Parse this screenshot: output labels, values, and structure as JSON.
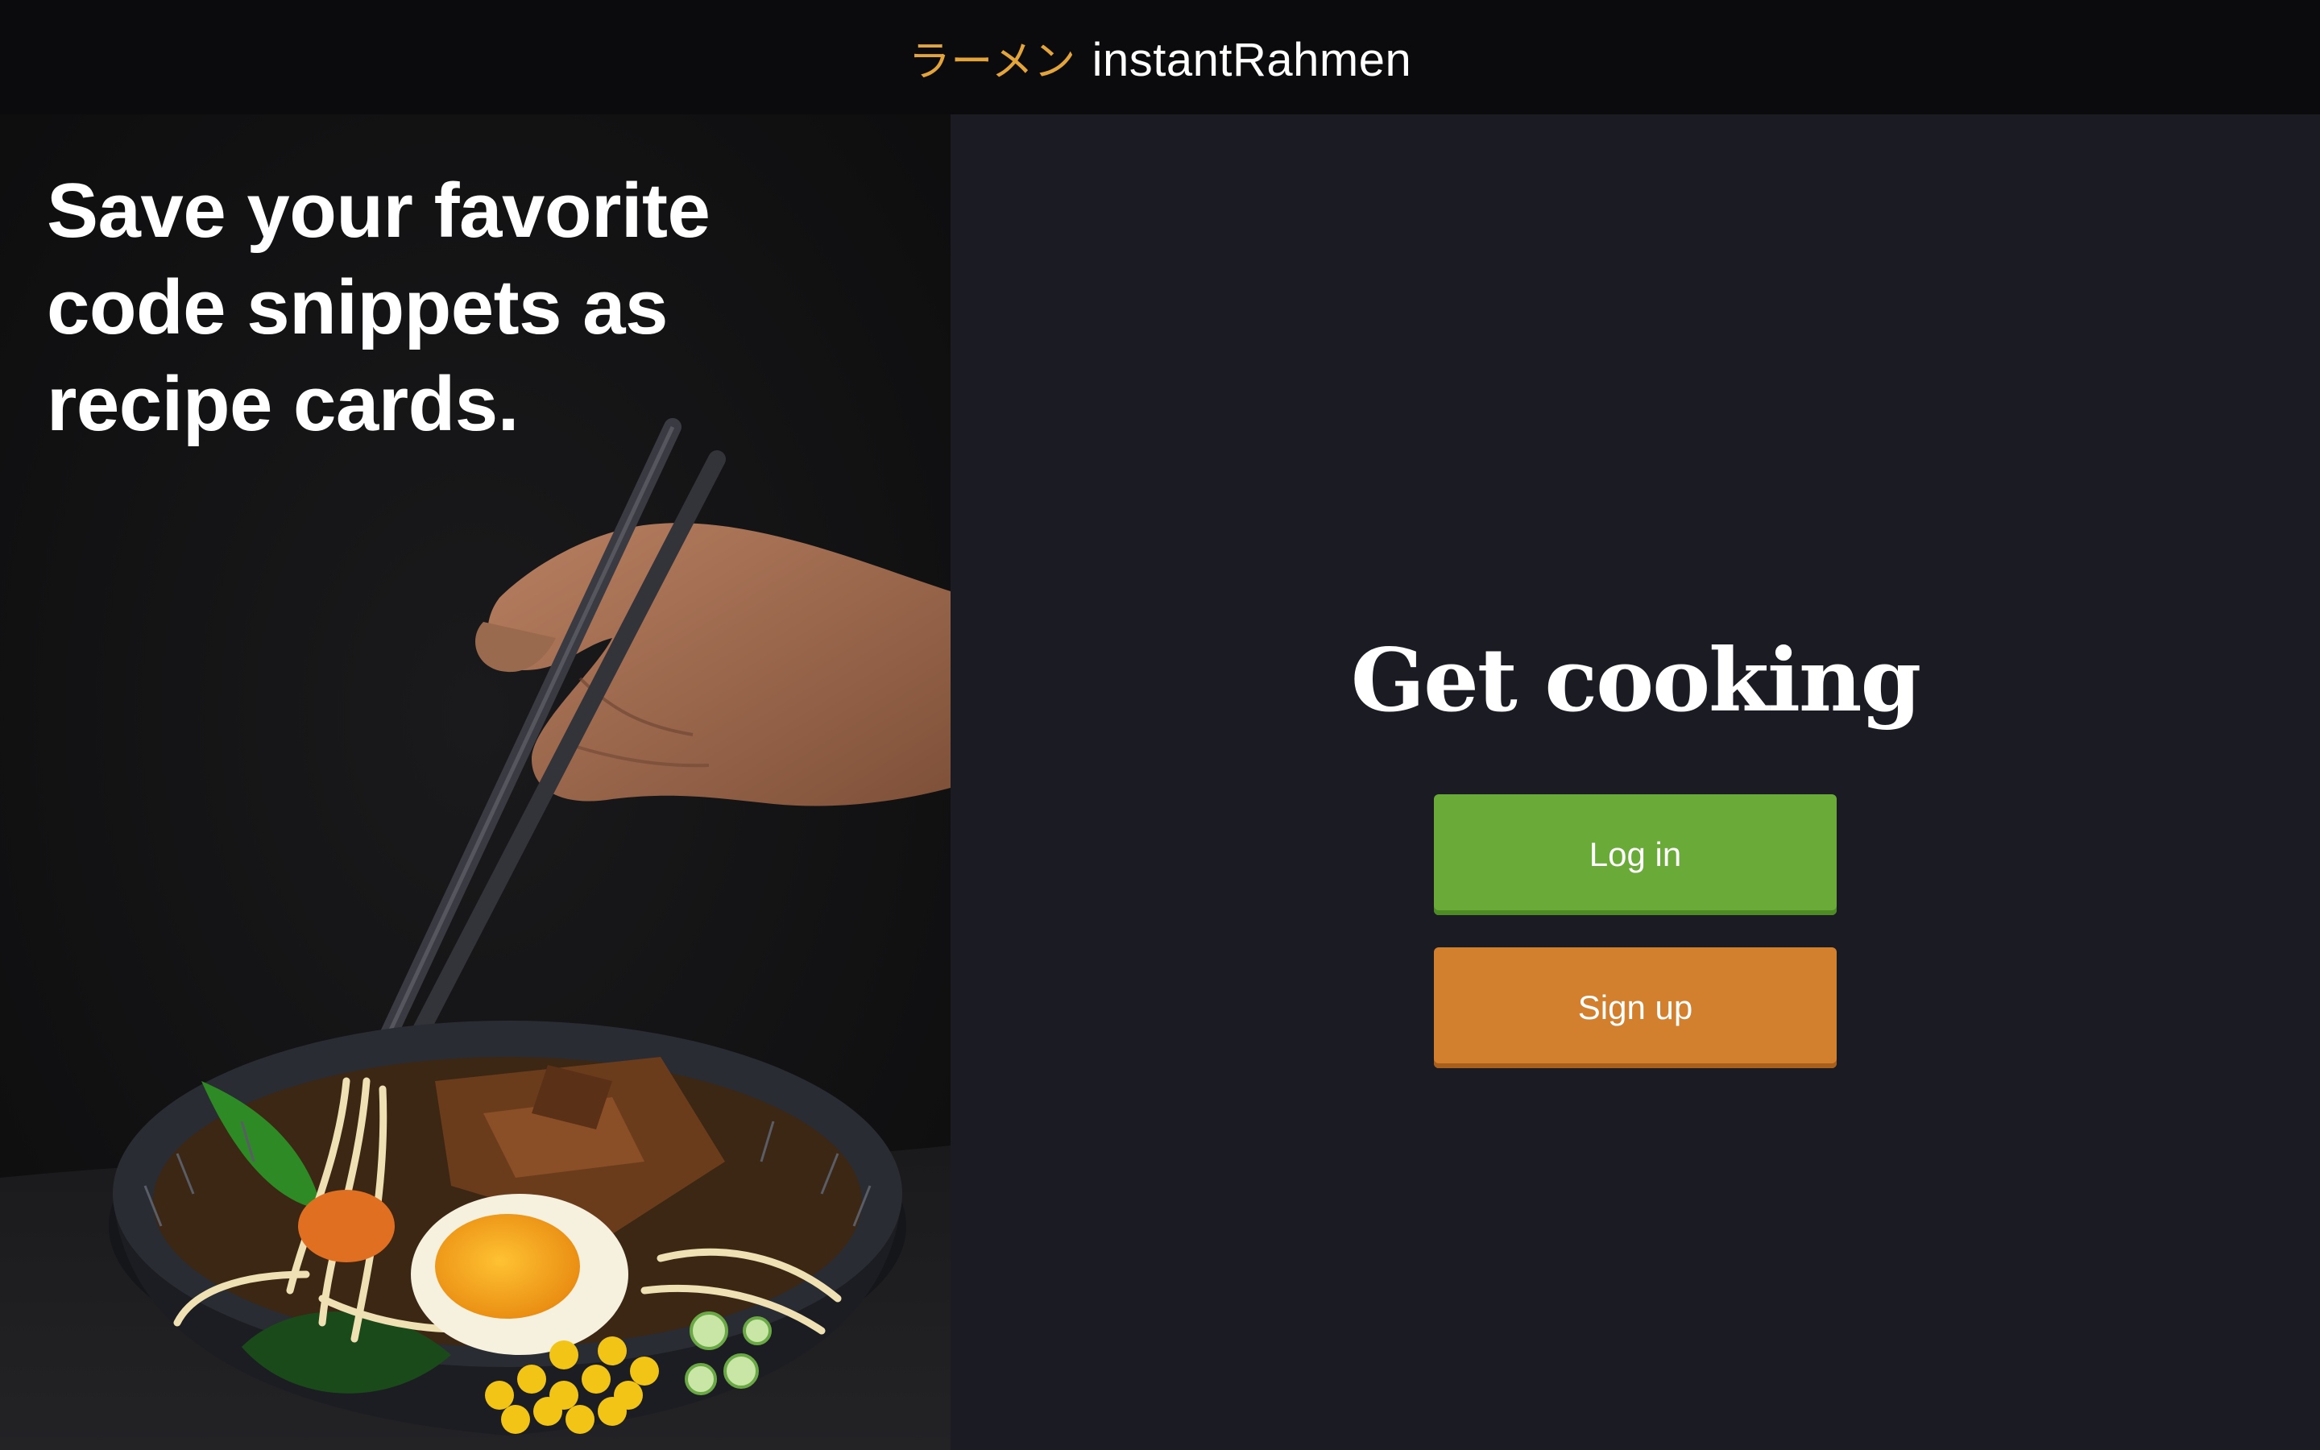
{
  "header": {
    "brand_kana": "ラーメン",
    "brand_name": "instantRahmen"
  },
  "hero": {
    "title": "Save your favorite\ncode snippets as\nrecipe cards.",
    "image_alt": "ramen-bowl-with-chopsticks-photo"
  },
  "auth": {
    "title": "Get cooking",
    "login_label": "Log in",
    "signup_label": "Sign up"
  },
  "colors": {
    "header_bg": "#0b0b0e",
    "panel_bg": "#1b1b24",
    "brand_accent": "#e3a43c",
    "login_green": "#6aaa38",
    "signup_orange": "#d27f2e"
  }
}
